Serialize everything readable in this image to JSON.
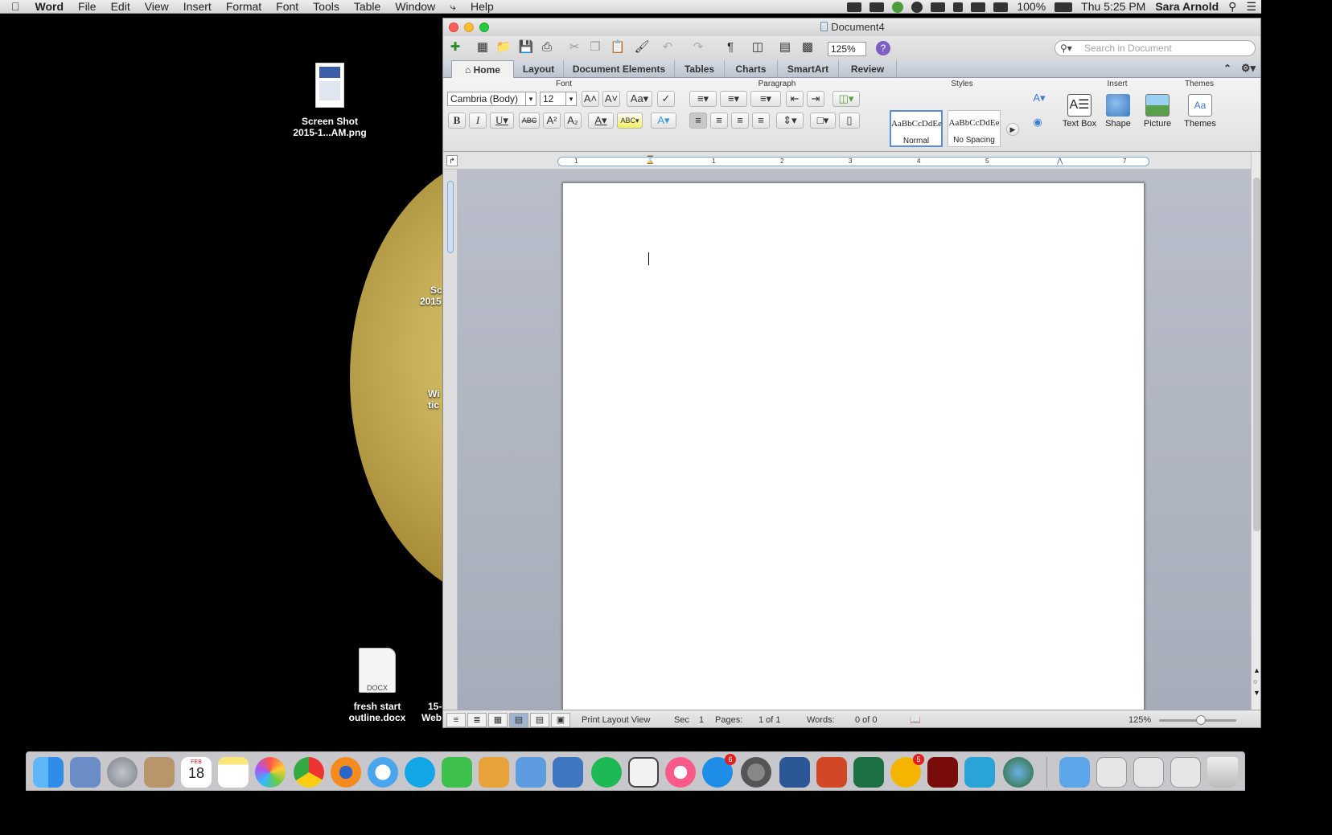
{
  "menubar": {
    "app": "Word",
    "items": [
      "File",
      "Edit",
      "View",
      "Insert",
      "Format",
      "Font",
      "Tools",
      "Table",
      "Window",
      "Help"
    ],
    "battery": "100%",
    "clock": "Thu 5:25 PM",
    "user": "Sara Arnold"
  },
  "desktop": {
    "icons": [
      {
        "label1": "Screen Shot",
        "label2": "2015-1...AM.png"
      },
      {
        "label1": "fresh start",
        "label2": "outline.docx",
        "badge": "DOCX"
      }
    ],
    "partial_texts": [
      "Sc",
      "2015",
      "Wi",
      "tic",
      "15-",
      "Web"
    ]
  },
  "window": {
    "title": "Document4",
    "zoom": "125%",
    "search_placeholder": "Search in Document",
    "tabs": [
      "Home",
      "Layout",
      "Document Elements",
      "Tables",
      "Charts",
      "SmartArt",
      "Review"
    ],
    "groups": {
      "font": "Font",
      "paragraph": "Paragraph",
      "styles": "Styles",
      "insert": "Insert",
      "themes": "Themes"
    },
    "font_name": "Cambria (Body)",
    "font_size": "12",
    "styles": [
      {
        "sample": "AaBbCcDdEe",
        "name": "Normal"
      },
      {
        "sample": "AaBbCcDdEe",
        "name": "No Spacing"
      }
    ],
    "insert_items": [
      "Text Box",
      "Shape",
      "Picture"
    ],
    "themes_label": "Themes",
    "ruler_numbers": [
      "1",
      "1",
      "2",
      "3",
      "4",
      "5",
      "7"
    ],
    "status": {
      "view": "Print Layout View",
      "sec_label": "Sec",
      "sec_value": "1",
      "pages_label": "Pages:",
      "pages_value": "1 of 1",
      "words_label": "Words:",
      "words_value": "0 of 0",
      "zoom": "125%"
    }
  },
  "dock": {
    "calendar_month": "FEB",
    "calendar_day": "18",
    "appstore_badge": "6",
    "outlook_badge": "5"
  }
}
